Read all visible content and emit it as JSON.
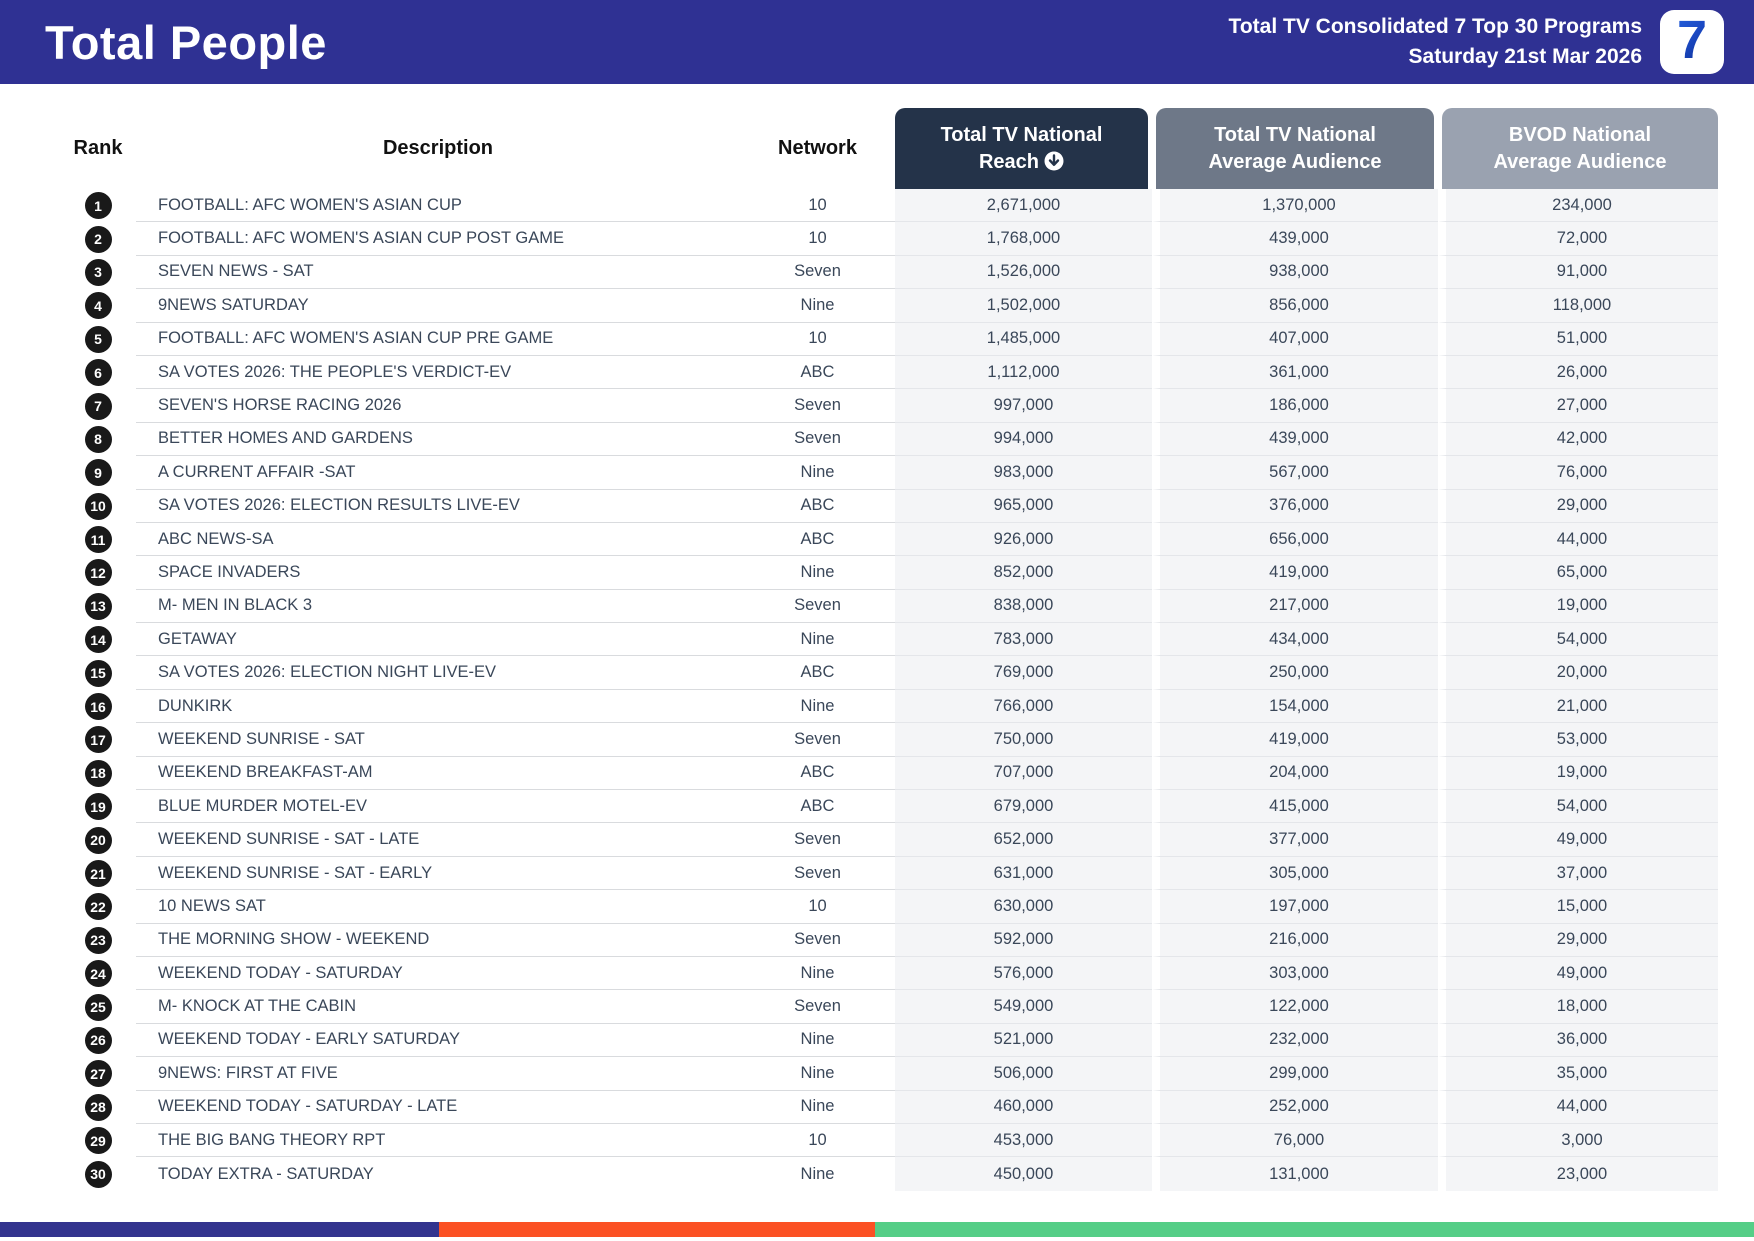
{
  "banner": {
    "title": "Total People",
    "subtitle_line1": "Total TV Consolidated 7 Top 30 Programs",
    "subtitle_line2": "Saturday 21st Mar 2026",
    "logo_text": "7",
    "bg_color": "#2F3193"
  },
  "table": {
    "headers": {
      "rank": "Rank",
      "description": "Description",
      "network": "Network",
      "reach_line1": "Total TV National",
      "reach_line2": "Reach",
      "reach_sort_icon": "arrow-down-circle",
      "avg_line1": "Total TV National",
      "avg_line2": "Average Audience",
      "bvod_line1": "BVOD National",
      "bvod_line2": "Average Audience"
    },
    "header_colors": {
      "reach_bg": "#243349",
      "avg_bg": "#6E7888",
      "bvod_bg": "#9AA2B0"
    },
    "rows": [
      {
        "rank": "1",
        "description": "FOOTBALL: AFC WOMEN'S ASIAN CUP",
        "network": "10",
        "reach": "2,671,000",
        "avg": "1,370,000",
        "bvod": "234,000"
      },
      {
        "rank": "2",
        "description": "FOOTBALL: AFC WOMEN'S ASIAN CUP POST GAME",
        "network": "10",
        "reach": "1,768,000",
        "avg": "439,000",
        "bvod": "72,000"
      },
      {
        "rank": "3",
        "description": "SEVEN NEWS - SAT",
        "network": "Seven",
        "reach": "1,526,000",
        "avg": "938,000",
        "bvod": "91,000"
      },
      {
        "rank": "4",
        "description": "9NEWS SATURDAY",
        "network": "Nine",
        "reach": "1,502,000",
        "avg": "856,000",
        "bvod": "118,000"
      },
      {
        "rank": "5",
        "description": "FOOTBALL: AFC WOMEN'S ASIAN CUP PRE GAME",
        "network": "10",
        "reach": "1,485,000",
        "avg": "407,000",
        "bvod": "51,000"
      },
      {
        "rank": "6",
        "description": "SA VOTES 2026: THE PEOPLE'S VERDICT-EV",
        "network": "ABC",
        "reach": "1,112,000",
        "avg": "361,000",
        "bvod": "26,000"
      },
      {
        "rank": "7",
        "description": "SEVEN'S HORSE RACING 2026",
        "network": "Seven",
        "reach": "997,000",
        "avg": "186,000",
        "bvod": "27,000"
      },
      {
        "rank": "8",
        "description": "BETTER HOMES AND GARDENS",
        "network": "Seven",
        "reach": "994,000",
        "avg": "439,000",
        "bvod": "42,000"
      },
      {
        "rank": "9",
        "description": "A CURRENT AFFAIR -SAT",
        "network": "Nine",
        "reach": "983,000",
        "avg": "567,000",
        "bvod": "76,000"
      },
      {
        "rank": "10",
        "description": "SA VOTES 2026: ELECTION RESULTS LIVE-EV",
        "network": "ABC",
        "reach": "965,000",
        "avg": "376,000",
        "bvod": "29,000"
      },
      {
        "rank": "11",
        "description": "ABC NEWS-SA",
        "network": "ABC",
        "reach": "926,000",
        "avg": "656,000",
        "bvod": "44,000"
      },
      {
        "rank": "12",
        "description": "SPACE INVADERS",
        "network": "Nine",
        "reach": "852,000",
        "avg": "419,000",
        "bvod": "65,000"
      },
      {
        "rank": "13",
        "description": "M- MEN IN BLACK 3",
        "network": "Seven",
        "reach": "838,000",
        "avg": "217,000",
        "bvod": "19,000"
      },
      {
        "rank": "14",
        "description": "GETAWAY",
        "network": "Nine",
        "reach": "783,000",
        "avg": "434,000",
        "bvod": "54,000"
      },
      {
        "rank": "15",
        "description": "SA VOTES 2026: ELECTION NIGHT LIVE-EV",
        "network": "ABC",
        "reach": "769,000",
        "avg": "250,000",
        "bvod": "20,000"
      },
      {
        "rank": "16",
        "description": "DUNKIRK",
        "network": "Nine",
        "reach": "766,000",
        "avg": "154,000",
        "bvod": "21,000"
      },
      {
        "rank": "17",
        "description": "WEEKEND SUNRISE - SAT",
        "network": "Seven",
        "reach": "750,000",
        "avg": "419,000",
        "bvod": "53,000"
      },
      {
        "rank": "18",
        "description": "WEEKEND BREAKFAST-AM",
        "network": "ABC",
        "reach": "707,000",
        "avg": "204,000",
        "bvod": "19,000"
      },
      {
        "rank": "19",
        "description": "BLUE MURDER MOTEL-EV",
        "network": "ABC",
        "reach": "679,000",
        "avg": "415,000",
        "bvod": "54,000"
      },
      {
        "rank": "20",
        "description": "WEEKEND SUNRISE - SAT - LATE",
        "network": "Seven",
        "reach": "652,000",
        "avg": "377,000",
        "bvod": "49,000"
      },
      {
        "rank": "21",
        "description": "WEEKEND SUNRISE - SAT - EARLY",
        "network": "Seven",
        "reach": "631,000",
        "avg": "305,000",
        "bvod": "37,000"
      },
      {
        "rank": "22",
        "description": "10 NEWS SAT",
        "network": "10",
        "reach": "630,000",
        "avg": "197,000",
        "bvod": "15,000"
      },
      {
        "rank": "23",
        "description": "THE MORNING SHOW - WEEKEND",
        "network": "Seven",
        "reach": "592,000",
        "avg": "216,000",
        "bvod": "29,000"
      },
      {
        "rank": "24",
        "description": "WEEKEND TODAY - SATURDAY",
        "network": "Nine",
        "reach": "576,000",
        "avg": "303,000",
        "bvod": "49,000"
      },
      {
        "rank": "25",
        "description": "M- KNOCK AT THE CABIN",
        "network": "Seven",
        "reach": "549,000",
        "avg": "122,000",
        "bvod": "18,000"
      },
      {
        "rank": "26",
        "description": "WEEKEND TODAY - EARLY SATURDAY",
        "network": "Nine",
        "reach": "521,000",
        "avg": "232,000",
        "bvod": "36,000"
      },
      {
        "rank": "27",
        "description": "9NEWS: FIRST AT FIVE",
        "network": "Nine",
        "reach": "506,000",
        "avg": "299,000",
        "bvod": "35,000"
      },
      {
        "rank": "28",
        "description": "WEEKEND TODAY - SATURDAY - LATE",
        "network": "Nine",
        "reach": "460,000",
        "avg": "252,000",
        "bvod": "44,000"
      },
      {
        "rank": "29",
        "description": "THE BIG BANG THEORY RPT",
        "network": "10",
        "reach": "453,000",
        "avg": "76,000",
        "bvod": "3,000"
      },
      {
        "rank": "30",
        "description": "TODAY EXTRA - SATURDAY",
        "network": "Nine",
        "reach": "450,000",
        "avg": "131,000",
        "bvod": "23,000"
      }
    ]
  },
  "footer": {
    "segment_colors": [
      "#33348E",
      "#FB5124",
      "#55CE87"
    ]
  }
}
